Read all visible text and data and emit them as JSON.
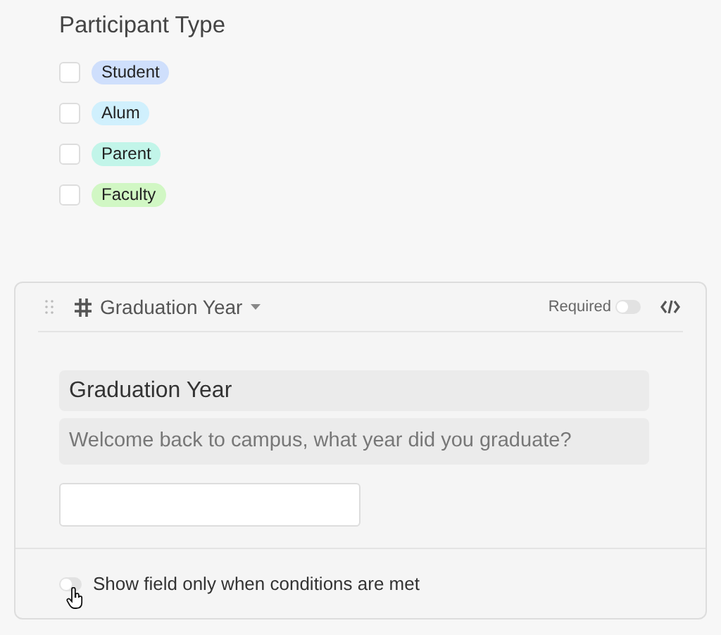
{
  "section": {
    "title": "Participant Type",
    "options": [
      {
        "label": "Student",
        "checked": false,
        "color": "#cfdffc"
      },
      {
        "label": "Alum",
        "checked": false,
        "color": "#d0f0fd"
      },
      {
        "label": "Parent",
        "checked": false,
        "color": "#c2f5e9"
      },
      {
        "label": "Faculty",
        "checked": false,
        "color": "#d1f7c4"
      }
    ]
  },
  "field_card": {
    "field_name": "Graduation Year",
    "required_label": "Required",
    "required": false,
    "title": "Graduation Year",
    "description": "Welcome back to campus, what year did you graduate?",
    "conditions_label": "Show field only when conditions are met",
    "conditions_on": false
  }
}
